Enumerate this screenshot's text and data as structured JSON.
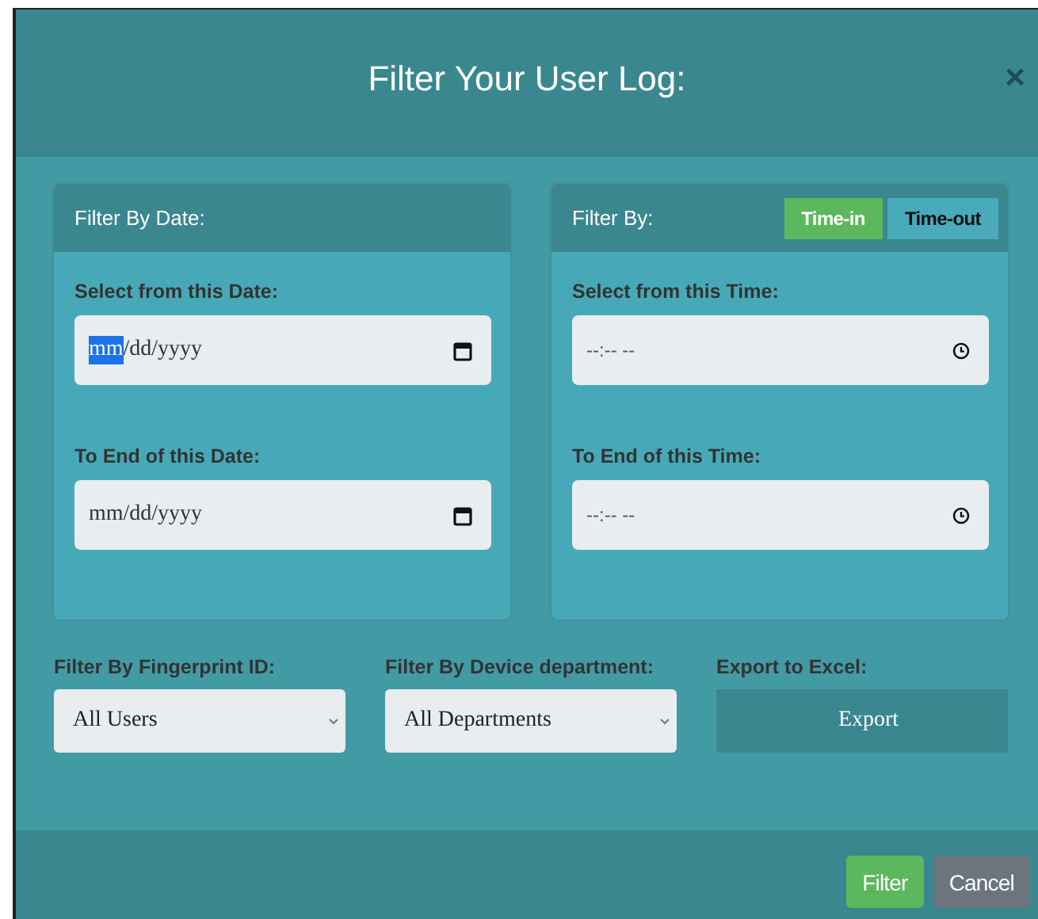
{
  "dialog": {
    "title": "Filter Your User Log:",
    "close": "×"
  },
  "date_panel": {
    "title": "Filter By Date:",
    "fields": [
      {
        "label": "Select from this Date:",
        "kind": "date",
        "segments": [
          {
            "text": "mm",
            "selected": true
          },
          {
            "text": "/dd/yyyy",
            "selected": false
          }
        ]
      },
      {
        "label": "To End of this Date:",
        "kind": "date",
        "segments": [
          {
            "text": "mm/dd/yyyy",
            "selected": false
          }
        ]
      }
    ]
  },
  "time_panel": {
    "title": "Filter By:",
    "toggles": [
      {
        "label": "Time-in",
        "selected": true
      },
      {
        "label": "Time-out",
        "selected": false
      }
    ],
    "fields": [
      {
        "label": "Select from this Time:",
        "kind": "time",
        "segments": [
          {
            "text": "--:-- --",
            "selected": false
          }
        ]
      },
      {
        "label": "To End of this Time:",
        "kind": "time",
        "segments": [
          {
            "text": "--:-- --",
            "selected": false
          }
        ]
      }
    ]
  },
  "filters": [
    {
      "label": "Filter By Fingerprint ID:",
      "kind": "select",
      "value": "All Users"
    },
    {
      "label": "Filter By Device department:",
      "kind": "select",
      "value": "All Departments"
    },
    {
      "label": "Export to Excel:",
      "kind": "button",
      "value": "Export"
    }
  ],
  "footer_buttons": [
    {
      "label": "Filter",
      "kind": "primary"
    },
    {
      "label": "Cancel",
      "kind": "secondary"
    }
  ]
}
